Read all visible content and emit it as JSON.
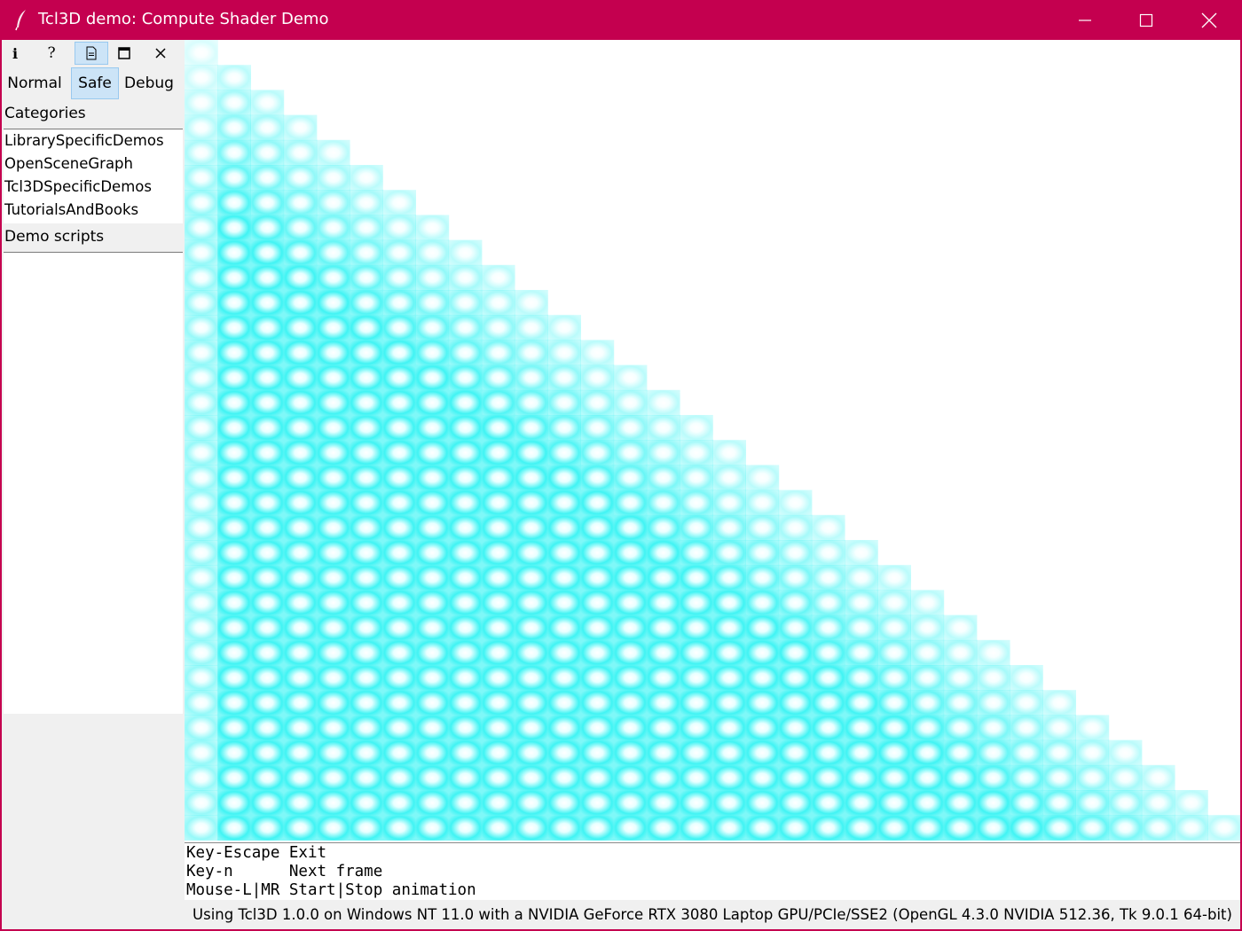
{
  "window": {
    "title": "Tcl3D demo: Compute Shader Demo",
    "title_bar_color": "#c4004f",
    "controls": [
      "minimize-icon",
      "maximize-icon",
      "close-icon"
    ]
  },
  "toolbar": {
    "info_label": "i",
    "help_label": "?",
    "doc_icon": "document-icon",
    "window_icon": "window-icon",
    "close_label": "×"
  },
  "modes": {
    "items": [
      "Normal",
      "Safe",
      "Debug"
    ],
    "selected": "Safe"
  },
  "categories": {
    "label": "Categories",
    "items": [
      "LibrarySpecificDemos",
      "OpenSceneGraph",
      "Tcl3DSpecificDemos",
      "TutorialsAndBooks"
    ]
  },
  "demo_scripts": {
    "label": "Demo scripts",
    "items": []
  },
  "canvas": {
    "pattern_color": "#00ffff",
    "background": "#ffffff"
  },
  "keys": {
    "lines": [
      "Key-Escape Exit",
      "Key-n      Next frame",
      "Mouse-L|MR Start|Stop animation"
    ]
  },
  "status": {
    "text": "Using Tcl3D 1.0.0 on Windows NT 11.0 with a NVIDIA GeForce RTX 3080 Laptop GPU/PCIe/SSE2 (OpenGL 4.3.0 NVIDIA 512.36, Tk 9.0.1 64-bit)"
  }
}
